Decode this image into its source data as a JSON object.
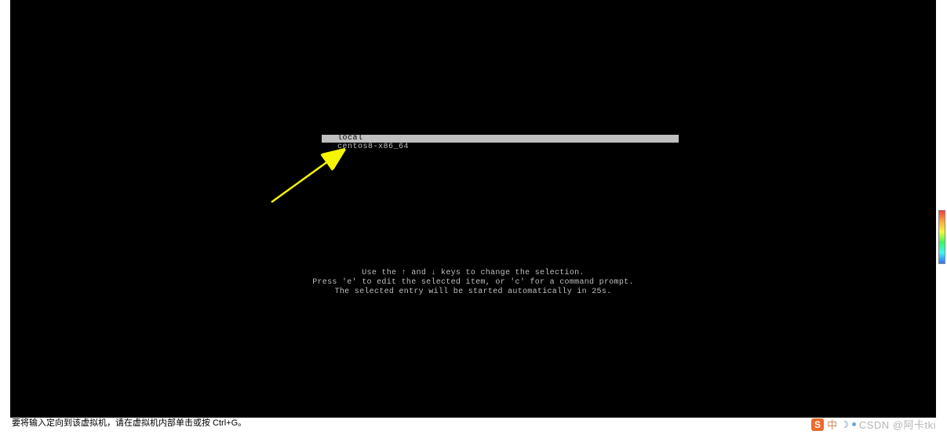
{
  "boot_menu": {
    "items": [
      {
        "label": "local",
        "selected": true
      },
      {
        "label": "centos8-x86_64",
        "selected": false
      }
    ]
  },
  "help": {
    "line1": "Use the ↑ and ↓ keys to change the selection.",
    "line2": "Press 'e' to edit the selected item, or 'c' for a command prompt.",
    "line3_prefix": "The selected entry will be started automatically in ",
    "countdown": "25",
    "line3_suffix": "s."
  },
  "status_bar": {
    "message": "要将输入定向到该虚拟机，请在虚拟机内部单击或按 Ctrl+G。"
  },
  "watermark": {
    "badge": "S",
    "chinese": "中",
    "moon": "☽",
    "text": "CSDN @阿卡tki"
  }
}
